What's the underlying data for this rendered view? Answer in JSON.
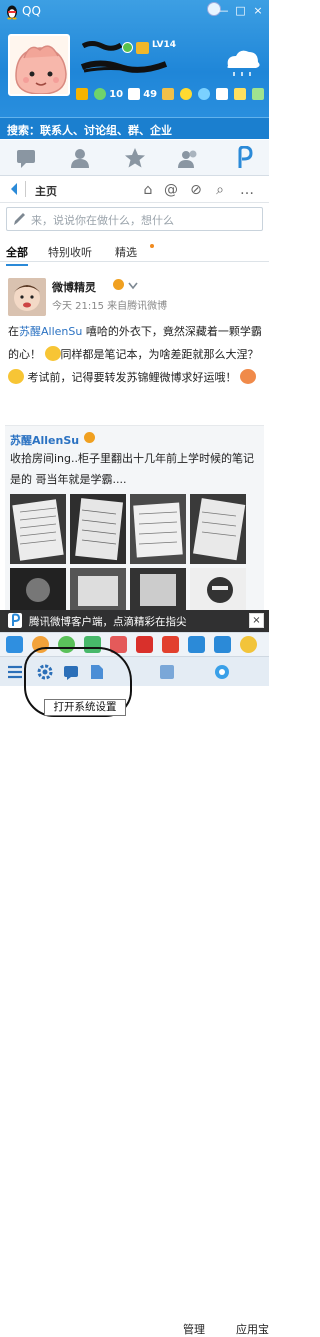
{
  "window": {
    "title": "QQ",
    "controls": [
      "—",
      "□",
      "×"
    ]
  },
  "profile": {
    "level": "LV14",
    "indicators": [
      {
        "name": "zone-icon",
        "text": ""
      },
      {
        "name": "weibo-icon",
        "text": "10"
      },
      {
        "name": "mail-icon",
        "text": "49"
      },
      {
        "name": "wallet-icon",
        "text": ""
      },
      {
        "name": "game-icon",
        "text": ""
      }
    ]
  },
  "search": {
    "placeholder": "搜索：联系人、讨论组、群、企业"
  },
  "main_tabs": [
    "messages",
    "contacts",
    "favorites",
    "groups",
    "weibo"
  ],
  "nav": {
    "title": "主页"
  },
  "compose": {
    "placeholder": "来，说说你在做什么，想什么"
  },
  "feed_tabs": [
    {
      "label": "全部",
      "active": true
    },
    {
      "label": "特别收听",
      "active": false
    },
    {
      "label": "精选",
      "active": false
    }
  ],
  "post1": {
    "author": "微博精灵",
    "meta": "今天 21:15   来自腾讯微博",
    "segments": [
      {
        "t": "在",
        "hl": false
      },
      {
        "t": "苏醒AllenSu",
        "hl": true
      },
      {
        "t": " 嘻哈的外衣下，竟然深藏着一颗学霸的心！",
        "hl": false
      },
      {
        "t": "同样都是笔记本，为啥差距就那么大涅？",
        "hl": false
      },
      {
        "t": "考试前，记得要转发苏锦鲤微博求好运哦！",
        "hl": false
      }
    ]
  },
  "repost": {
    "author": "苏醒AllenSu",
    "text": "收拾房间ing..柜子里翻出十几年前上学时候的笔记 是的 哥当年就是学霸...."
  },
  "toast": {
    "text": "腾讯微博客户端，点滴精彩在指尖",
    "close": "×"
  },
  "bottom": {
    "manager_label": "管理",
    "apps_label": "应用宝",
    "tooltip": "打开系统设置"
  },
  "colors": {
    "header": "#2a8fde",
    "link": "#2b72c2",
    "accent": "#2b8ad8"
  }
}
